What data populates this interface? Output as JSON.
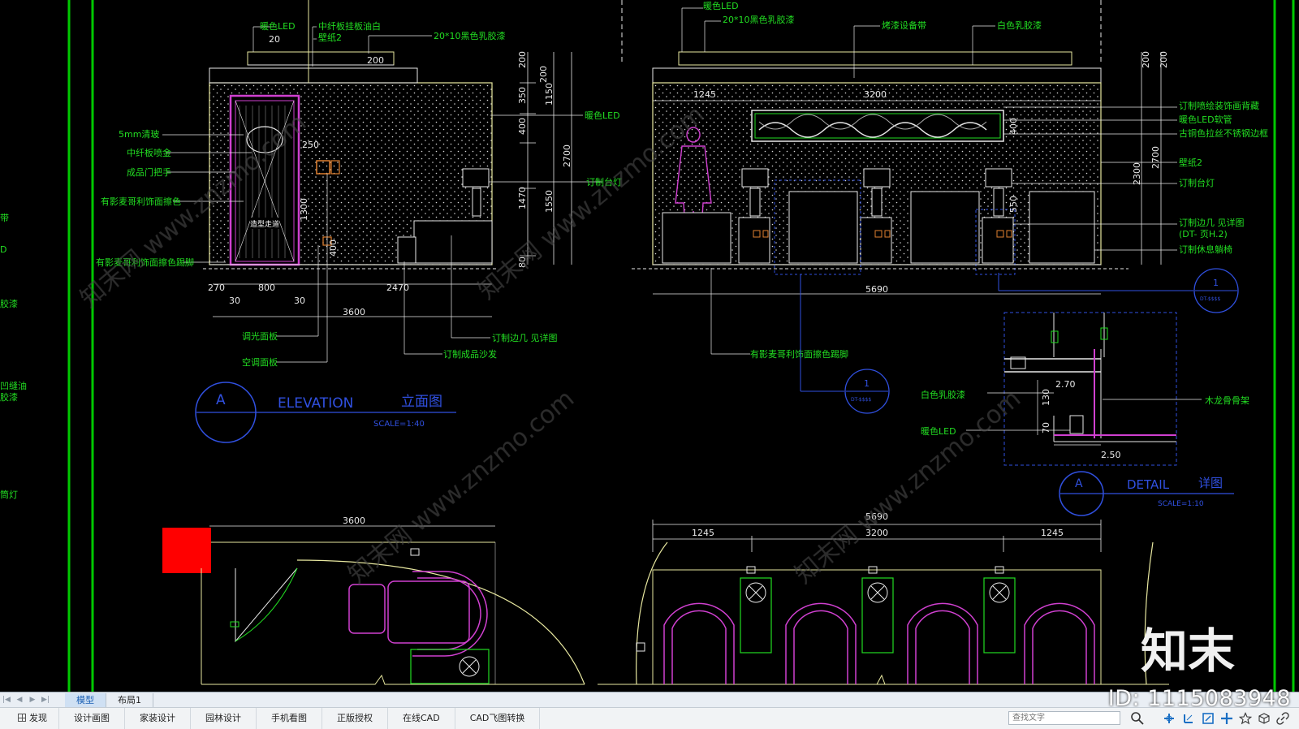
{
  "drawing": {
    "elevation_a": {
      "notes_top": [
        "暖色LED",
        "中纤板挂板油白",
        "壁纸2",
        "20*10黑色乳胶漆"
      ],
      "notes_left": [
        "5mm清玻",
        "中纤板喷金",
        "成品门把手",
        "有影麦哥利饰面擦色",
        "有影麦哥利饰面擦色踢脚"
      ],
      "notes_bottom": [
        "调光面板",
        "空调面板",
        "订制成品沙发",
        "订制边几 见详图"
      ],
      "notes_right": [
        "暖色LED",
        "订制台灯"
      ],
      "door_label": "造型走道",
      "dims_top": [
        "20",
        "200"
      ],
      "dims_inner": [
        "250",
        "1300",
        "400"
      ],
      "dims_right": [
        "200",
        "200",
        "350",
        "400",
        "1150",
        "2700",
        "1470",
        "1550",
        "80"
      ],
      "dims_bottom": [
        "270",
        "800",
        "2470",
        "30",
        "30",
        "3600"
      ]
    },
    "elevation_b": {
      "notes_top": [
        "暖色LED",
        "20*10黑色乳胶漆",
        "烤漆设备带",
        "白色乳胶漆"
      ],
      "notes_right": [
        "订制喷绘装饰画背藏",
        "暖色LED软管",
        "古铜色拉丝不锈钢边框",
        "壁纸2",
        "订制台灯",
        "订制边几 见详图",
        "(DT-  页H.2)",
        "订制休息躺椅"
      ],
      "notes_bottom": [
        "有影麦哥利饰面擦色踢脚"
      ],
      "dims_top": [
        "1245",
        "3200"
      ],
      "dims_right": [
        "200",
        "400",
        "550",
        "2300",
        "200",
        "2700"
      ],
      "dims_bottom": [
        "5690"
      ]
    },
    "left_edge_notes": [
      "带",
      "D",
      "胶漆",
      "凹缝油",
      "胶漆",
      "筒灯"
    ],
    "title_a": {
      "letter": "A",
      "english": "ELEVATION",
      "chinese": "立面图",
      "scale": "SCALE=1:40"
    },
    "title_detail": {
      "letter": "A",
      "english": "DETAIL",
      "chinese": "详图",
      "scale": "SCALE=1:10"
    },
    "section_marker_1": {
      "num": "1",
      "sub": "DT-$$$$"
    },
    "section_marker_2": {
      "num": "1",
      "sub": "DT-$$$$"
    },
    "detail": {
      "notes": [
        "白色乳胶漆",
        "暖色LED",
        "木龙骨骨架"
      ],
      "dims": [
        "2.70",
        "130",
        "70",
        "2.50"
      ]
    },
    "plan_a": {
      "dims": [
        "3600"
      ]
    },
    "plan_b": {
      "dims": [
        "5690",
        "1245",
        "3200",
        "1245"
      ]
    }
  },
  "tabs": {
    "model": "模型",
    "layout1": "布局1"
  },
  "statusbar": {
    "discover": "发现",
    "items": [
      "设计画图",
      "家装设计",
      "园林设计",
      "手机看图",
      "正版授权",
      "在线CAD",
      "CAD飞图转换"
    ],
    "search_placeholder": "查找文字"
  },
  "watermark": {
    "logo_text": "知末",
    "id_text": "ID: 1115083948",
    "tile": "知末网 www.znzmo.com"
  },
  "colors": {
    "annotation": "#22dd22",
    "dimension": "#e8e8e8",
    "outline": "#e8e8a0",
    "furniture": "#d040d0",
    "frame_green": "#00c800",
    "title_blue": "#3050e0"
  }
}
